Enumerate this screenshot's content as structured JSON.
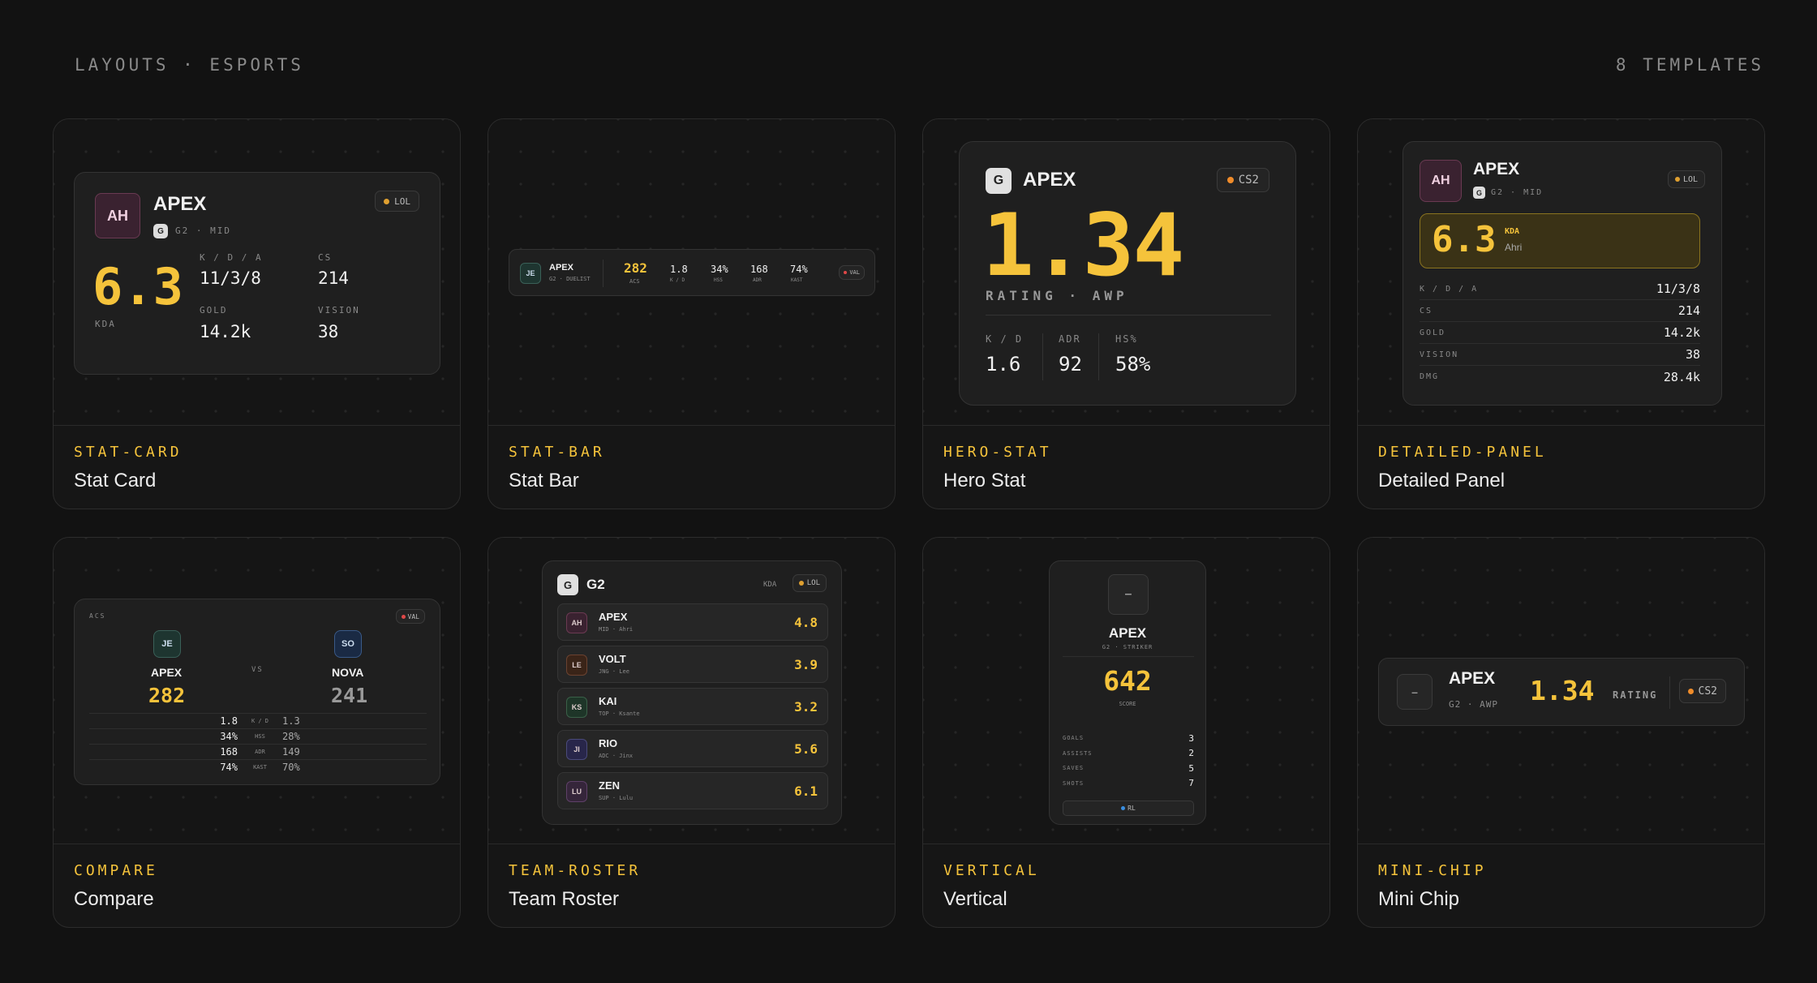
{
  "header": {
    "left": "LAYOUTS · ESPORTS",
    "right": "8 TEMPLATES"
  },
  "tiles": [
    {
      "code": "STAT-CARD",
      "name": "Stat Card"
    },
    {
      "code": "STAT-BAR",
      "name": "Stat Bar"
    },
    {
      "code": "HERO-STAT",
      "name": "Hero Stat"
    },
    {
      "code": "DETAILED-PANEL",
      "name": "Detailed Panel"
    },
    {
      "code": "COMPARE",
      "name": "Compare"
    },
    {
      "code": "TEAM-ROSTER",
      "name": "Team Roster"
    },
    {
      "code": "VERTICAL",
      "name": "Vertical"
    },
    {
      "code": "MINI-CHIP",
      "name": "Mini Chip"
    }
  ],
  "statcard": {
    "avatar": "AH",
    "name": "APEX",
    "team_logo": "G",
    "team": "G2 · MID",
    "game": "LOL",
    "big": "6.3",
    "big_label": "KDA",
    "kda_label": "K / D / A",
    "kda": "11/3/8",
    "cs_label": "CS",
    "cs": "214",
    "gold_label": "GOLD",
    "gold": "14.2k",
    "vision_label": "VISION",
    "vision": "38"
  },
  "statbar": {
    "avatar": "JE",
    "name": "APEX",
    "sub": "G2 · DUELIST",
    "acs": "282",
    "acs_label": "ACS",
    "stats": [
      {
        "v": "1.8",
        "l": "K / D"
      },
      {
        "v": "34%",
        "l": "HSS"
      },
      {
        "v": "168",
        "l": "ADR"
      },
      {
        "v": "74%",
        "l": "KAST"
      }
    ],
    "game": "VAL"
  },
  "hero": {
    "logo": "G",
    "name": "APEX",
    "game": "CS2",
    "big": "1.34",
    "label": "RATING · AWP",
    "stats": [
      {
        "l": "K / D",
        "v": "1.6"
      },
      {
        "l": "ADR",
        "v": "92"
      },
      {
        "l": "HS%",
        "v": "58%"
      }
    ]
  },
  "detailed": {
    "avatar": "AH",
    "name": "APEX",
    "team_logo": "G",
    "team": "G2 · MID",
    "game": "LOL",
    "big": "6.3",
    "big_label": "KDA",
    "champ": "Ahri",
    "rows": [
      {
        "l": "K / D / A",
        "v": "11/3/8"
      },
      {
        "l": "CS",
        "v": "214"
      },
      {
        "l": "GOLD",
        "v": "14.2k"
      },
      {
        "l": "VISION",
        "v": "38"
      },
      {
        "l": "DMG",
        "v": "28.4k"
      }
    ]
  },
  "compare": {
    "metric": "ACS",
    "game": "VAL",
    "p1": {
      "avatar": "JE",
      "name": "APEX",
      "score": "282"
    },
    "vs": "VS",
    "p2": {
      "avatar": "SO",
      "name": "NOVA",
      "score": "241"
    },
    "rows": [
      {
        "a": "1.8",
        "l": "K / D",
        "b": "1.3"
      },
      {
        "a": "34%",
        "l": "HSS",
        "b": "28%"
      },
      {
        "a": "168",
        "l": "ADR",
        "b": "149"
      },
      {
        "a": "74%",
        "l": "KAST",
        "b": "70%"
      }
    ]
  },
  "roster": {
    "logo": "G",
    "team": "G2",
    "metric": "KDA",
    "game": "LOL",
    "players": [
      {
        "av": "AH",
        "name": "APEX",
        "sub": "MID · Ahri",
        "v": "4.8"
      },
      {
        "av": "LE",
        "name": "VOLT",
        "sub": "JNG · Lee",
        "v": "3.9"
      },
      {
        "av": "KS",
        "name": "KAI",
        "sub": "TOP · Ksante",
        "v": "3.2"
      },
      {
        "av": "JI",
        "name": "RIO",
        "sub": "ADC · Jinx",
        "v": "5.6"
      },
      {
        "av": "LU",
        "name": "ZEN",
        "sub": "SUP · Lulu",
        "v": "6.1"
      }
    ]
  },
  "vertical": {
    "avatar": "–",
    "name": "APEX",
    "sub": "G2 · STRIKER",
    "score": "642",
    "score_label": "SCORE",
    "rows": [
      {
        "l": "GOALS",
        "v": "3"
      },
      {
        "l": "ASSISTS",
        "v": "2"
      },
      {
        "l": "SAVES",
        "v": "5"
      },
      {
        "l": "SHOTS",
        "v": "7"
      }
    ],
    "game": "RL"
  },
  "chip": {
    "avatar": "–",
    "name": "APEX",
    "sub": "G2 · AWP",
    "big": "1.34",
    "label": "RATING",
    "game": "CS2"
  },
  "colors": {
    "accent": "#f5c33b",
    "bg": "#121212",
    "card": "#1f1f1f",
    "lol_dot": "#e0a030",
    "cs2_dot": "#f08c2a",
    "val_dot": "#e04848",
    "rl_dot": "#3a8ee0"
  }
}
